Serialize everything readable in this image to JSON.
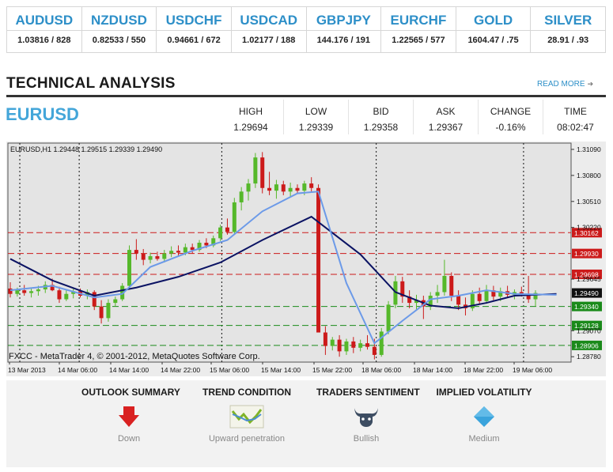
{
  "ticker": [
    {
      "symbol": "AUDUSD",
      "value": "1.03816 / 828"
    },
    {
      "symbol": "NZDUSD",
      "value": "0.82533 / 550"
    },
    {
      "symbol": "USDCHF",
      "value": "0.94661 / 672"
    },
    {
      "symbol": "USDCAD",
      "value": "1.02177 / 188"
    },
    {
      "symbol": "GBPJPY",
      "value": "144.176 / 191"
    },
    {
      "symbol": "EURCHF",
      "value": "1.22565 / 577"
    },
    {
      "symbol": "GOLD",
      "value": "1604.47 / .75"
    },
    {
      "symbol": "SILVER",
      "value": "28.91 / .93"
    }
  ],
  "section": {
    "title": "TECHNICAL ANALYSIS",
    "read_more": "READ MORE",
    "read_more_icon": "arrow-right-icon"
  },
  "instrument": {
    "pair": "EURUSD"
  },
  "quotes": [
    {
      "label": "HIGH",
      "value": "1.29694"
    },
    {
      "label": "LOW",
      "value": "1.29339"
    },
    {
      "label": "BID",
      "value": "1.29358"
    },
    {
      "label": "ASK",
      "value": "1.29367"
    },
    {
      "label": "CHANGE",
      "value": "-0.16%"
    },
    {
      "label": "TIME",
      "value": "08:02:47"
    }
  ],
  "chart_data": {
    "type": "candlestick",
    "header": "EURUSD,H1  1.29448 1.29515 1.29339 1.29490",
    "footer": "FXCC - MetaTrader 4, © 2001-2012, MetaQuotes Software Corp.",
    "ylim": [
      1.2872,
      1.3116
    ],
    "y_ticks": [
      "1.31090",
      "1.30800",
      "1.30510",
      "1.30220",
      "1.29645",
      "1.29070",
      "1.28780"
    ],
    "x_ticks": [
      "13 Mar 2013",
      "14 Mar 06:00",
      "14 Mar 14:00",
      "14 Mar 22:00",
      "15 Mar 06:00",
      "15 Mar 14:00",
      "15 Mar 22:00",
      "18 Mar 06:00",
      "18 Mar 14:00",
      "18 Mar 22:00",
      "19 Mar 06:00"
    ],
    "levels": [
      {
        "value": 1.30162,
        "label": "1.30162",
        "color": "#cc1a1a"
      },
      {
        "value": 1.2993,
        "label": "1.29930",
        "color": "#cc1a1a"
      },
      {
        "value": 1.29698,
        "label": "1.29698",
        "color": "#cc1a1a"
      },
      {
        "value": 1.2949,
        "label": "1.29490",
        "color": "#111111"
      },
      {
        "value": 1.2934,
        "label": "1.29340",
        "color": "#1a8a1a"
      },
      {
        "value": 1.29128,
        "label": "1.29128",
        "color": "#1a8a1a"
      },
      {
        "value": 1.28906,
        "label": "1.28906",
        "color": "#1a8a1a"
      }
    ],
    "candles": [
      {
        "o": 1.2954,
        "h": 1.2961,
        "l": 1.2944,
        "c": 1.2948
      },
      {
        "o": 1.2948,
        "h": 1.2955,
        "l": 1.2945,
        "c": 1.2952
      },
      {
        "o": 1.2952,
        "h": 1.2958,
        "l": 1.2946,
        "c": 1.2949
      },
      {
        "o": 1.2949,
        "h": 1.2954,
        "l": 1.2944,
        "c": 1.2951
      },
      {
        "o": 1.2951,
        "h": 1.2957,
        "l": 1.2946,
        "c": 1.2953
      },
      {
        "o": 1.2953,
        "h": 1.2962,
        "l": 1.2949,
        "c": 1.2958
      },
      {
        "o": 1.2958,
        "h": 1.2965,
        "l": 1.2951,
        "c": 1.2952
      },
      {
        "o": 1.2952,
        "h": 1.2956,
        "l": 1.2938,
        "c": 1.2942
      },
      {
        "o": 1.2942,
        "h": 1.2952,
        "l": 1.294,
        "c": 1.2948
      },
      {
        "o": 1.2948,
        "h": 1.2954,
        "l": 1.2943,
        "c": 1.2951
      },
      {
        "o": 1.2951,
        "h": 1.2954,
        "l": 1.2944,
        "c": 1.2946
      },
      {
        "o": 1.2946,
        "h": 1.2953,
        "l": 1.2942,
        "c": 1.295
      },
      {
        "o": 1.295,
        "h": 1.2952,
        "l": 1.293,
        "c": 1.2934
      },
      {
        "o": 1.2934,
        "h": 1.2941,
        "l": 1.2915,
        "c": 1.2921
      },
      {
        "o": 1.2921,
        "h": 1.2942,
        "l": 1.2917,
        "c": 1.2938
      },
      {
        "o": 1.2938,
        "h": 1.2945,
        "l": 1.2934,
        "c": 1.2942
      },
      {
        "o": 1.2942,
        "h": 1.296,
        "l": 1.294,
        "c": 1.2957
      },
      {
        "o": 1.2957,
        "h": 1.3002,
        "l": 1.2954,
        "c": 1.2997
      },
      {
        "o": 1.2997,
        "h": 1.3009,
        "l": 1.2986,
        "c": 1.2993
      },
      {
        "o": 1.2993,
        "h": 1.2998,
        "l": 1.298,
        "c": 1.2986
      },
      {
        "o": 1.2986,
        "h": 1.2994,
        "l": 1.2982,
        "c": 1.299
      },
      {
        "o": 1.299,
        "h": 1.2995,
        "l": 1.2985,
        "c": 1.2987
      },
      {
        "o": 1.2987,
        "h": 1.2997,
        "l": 1.2983,
        "c": 1.2993
      },
      {
        "o": 1.2993,
        "h": 1.3001,
        "l": 1.2989,
        "c": 1.2996
      },
      {
        "o": 1.2996,
        "h": 1.3002,
        "l": 1.299,
        "c": 1.2994
      },
      {
        "o": 1.2994,
        "h": 1.3004,
        "l": 1.2991,
        "c": 1.3
      },
      {
        "o": 1.3,
        "h": 1.3004,
        "l": 1.2993,
        "c": 1.2997
      },
      {
        "o": 1.2997,
        "h": 1.3008,
        "l": 1.2995,
        "c": 1.3005
      },
      {
        "o": 1.3005,
        "h": 1.301,
        "l": 1.2999,
        "c": 1.3002
      },
      {
        "o": 1.3002,
        "h": 1.3013,
        "l": 1.3,
        "c": 1.301
      },
      {
        "o": 1.301,
        "h": 1.3025,
        "l": 1.3007,
        "c": 1.3022
      },
      {
        "o": 1.3022,
        "h": 1.3032,
        "l": 1.3014,
        "c": 1.3017
      },
      {
        "o": 1.3017,
        "h": 1.3055,
        "l": 1.3015,
        "c": 1.305
      },
      {
        "o": 1.305,
        "h": 1.3067,
        "l": 1.3041,
        "c": 1.3062
      },
      {
        "o": 1.3062,
        "h": 1.3076,
        "l": 1.3052,
        "c": 1.3071
      },
      {
        "o": 1.3071,
        "h": 1.3105,
        "l": 1.3066,
        "c": 1.31
      },
      {
        "o": 1.31,
        "h": 1.3106,
        "l": 1.306,
        "c": 1.3066
      },
      {
        "o": 1.3066,
        "h": 1.3084,
        "l": 1.3058,
        "c": 1.3063
      },
      {
        "o": 1.3063,
        "h": 1.3075,
        "l": 1.3054,
        "c": 1.307
      },
      {
        "o": 1.307,
        "h": 1.3074,
        "l": 1.3058,
        "c": 1.3062
      },
      {
        "o": 1.3062,
        "h": 1.3072,
        "l": 1.3056,
        "c": 1.3066
      },
      {
        "o": 1.3066,
        "h": 1.307,
        "l": 1.306,
        "c": 1.3063
      },
      {
        "o": 1.3063,
        "h": 1.3074,
        "l": 1.3058,
        "c": 1.3071
      },
      {
        "o": 1.3071,
        "h": 1.3078,
        "l": 1.3062,
        "c": 1.3066
      },
      {
        "o": 1.3066,
        "h": 1.307,
        "l": 1.2995,
        "c": 1.2905
      },
      {
        "o": 1.2905,
        "h": 1.2912,
        "l": 1.288,
        "c": 1.289
      },
      {
        "o": 1.289,
        "h": 1.29,
        "l": 1.2885,
        "c": 1.2897
      },
      {
        "o": 1.2897,
        "h": 1.2902,
        "l": 1.2878,
        "c": 1.2884
      },
      {
        "o": 1.2884,
        "h": 1.2898,
        "l": 1.288,
        "c": 1.2895
      },
      {
        "o": 1.2895,
        "h": 1.29,
        "l": 1.2882,
        "c": 1.2888
      },
      {
        "o": 1.2888,
        "h": 1.2897,
        "l": 1.2884,
        "c": 1.2893
      },
      {
        "o": 1.2893,
        "h": 1.2902,
        "l": 1.2886,
        "c": 1.2889
      },
      {
        "o": 1.2889,
        "h": 1.2898,
        "l": 1.2875,
        "c": 1.288
      },
      {
        "o": 1.288,
        "h": 1.291,
        "l": 1.2878,
        "c": 1.2906
      },
      {
        "o": 1.2906,
        "h": 1.294,
        "l": 1.2903,
        "c": 1.2936
      },
      {
        "o": 1.2936,
        "h": 1.2968,
        "l": 1.2932,
        "c": 1.2962
      },
      {
        "o": 1.2962,
        "h": 1.2967,
        "l": 1.2938,
        "c": 1.2945
      },
      {
        "o": 1.2945,
        "h": 1.2952,
        "l": 1.2932,
        "c": 1.2938
      },
      {
        "o": 1.2938,
        "h": 1.2947,
        "l": 1.293,
        "c": 1.2941
      },
      {
        "o": 1.2941,
        "h": 1.2946,
        "l": 1.292,
        "c": 1.2934
      },
      {
        "o": 1.2934,
        "h": 1.295,
        "l": 1.293,
        "c": 1.2946
      },
      {
        "o": 1.2946,
        "h": 1.2958,
        "l": 1.2938,
        "c": 1.295
      },
      {
        "o": 1.295,
        "h": 1.2986,
        "l": 1.2946,
        "c": 1.2968
      },
      {
        "o": 1.2968,
        "h": 1.2972,
        "l": 1.294,
        "c": 1.2946
      },
      {
        "o": 1.2946,
        "h": 1.2952,
        "l": 1.293,
        "c": 1.2936
      },
      {
        "o": 1.2936,
        "h": 1.2944,
        "l": 1.2924,
        "c": 1.2932
      },
      {
        "o": 1.2932,
        "h": 1.2952,
        "l": 1.2929,
        "c": 1.2948
      },
      {
        "o": 1.2948,
        "h": 1.2955,
        "l": 1.2936,
        "c": 1.294
      },
      {
        "o": 1.294,
        "h": 1.2958,
        "l": 1.2937,
        "c": 1.2952
      },
      {
        "o": 1.2952,
        "h": 1.2957,
        "l": 1.2941,
        "c": 1.2945
      },
      {
        "o": 1.2945,
        "h": 1.2955,
        "l": 1.294,
        "c": 1.2951
      },
      {
        "o": 1.2951,
        "h": 1.2957,
        "l": 1.2944,
        "c": 1.2947
      },
      {
        "o": 1.2947,
        "h": 1.2953,
        "l": 1.2942,
        "c": 1.295
      },
      {
        "o": 1.295,
        "h": 1.2956,
        "l": 1.2945,
        "c": 1.2948
      },
      {
        "o": 1.2948,
        "h": 1.2968,
        "l": 1.2938,
        "c": 1.2942
      },
      {
        "o": 1.2942,
        "h": 1.2952,
        "l": 1.2934,
        "c": 1.2949
      }
    ],
    "ma_slow": [
      {
        "i": 0,
        "v": 1.2987
      },
      {
        "i": 6,
        "v": 1.2963
      },
      {
        "i": 12,
        "v": 1.2946
      },
      {
        "i": 18,
        "v": 1.2955
      },
      {
        "i": 24,
        "v": 1.2967
      },
      {
        "i": 30,
        "v": 1.2983
      },
      {
        "i": 36,
        "v": 1.3008
      },
      {
        "i": 43,
        "v": 1.3034
      },
      {
        "i": 50,
        "v": 1.2992
      },
      {
        "i": 55,
        "v": 1.295
      },
      {
        "i": 60,
        "v": 1.2935
      },
      {
        "i": 64,
        "v": 1.2932
      },
      {
        "i": 68,
        "v": 1.2938
      },
      {
        "i": 72,
        "v": 1.2946
      },
      {
        "i": 78,
        "v": 1.2948
      }
    ],
    "ma_fast": [
      {
        "i": 0,
        "v": 1.2952
      },
      {
        "i": 6,
        "v": 1.2957
      },
      {
        "i": 12,
        "v": 1.2944
      },
      {
        "i": 16,
        "v": 1.2948
      },
      {
        "i": 20,
        "v": 1.2978
      },
      {
        "i": 26,
        "v": 1.2996
      },
      {
        "i": 31,
        "v": 1.3008
      },
      {
        "i": 36,
        "v": 1.304
      },
      {
        "i": 41,
        "v": 1.306
      },
      {
        "i": 44,
        "v": 1.3062
      },
      {
        "i": 48,
        "v": 1.296
      },
      {
        "i": 52,
        "v": 1.2893
      },
      {
        "i": 56,
        "v": 1.2918
      },
      {
        "i": 60,
        "v": 1.2942
      },
      {
        "i": 64,
        "v": 1.2946
      },
      {
        "i": 68,
        "v": 1.2952
      },
      {
        "i": 72,
        "v": 1.2948
      },
      {
        "i": 78,
        "v": 1.2947
      }
    ]
  },
  "summary": [
    {
      "label": "OUTLOOK SUMMARY",
      "value": "Down",
      "icon": "down-arrow-icon"
    },
    {
      "label": "TREND CONDITION",
      "value": "Upward penetration",
      "icon": "trend-chart-icon"
    },
    {
      "label": "TRADERS SENTIMENT",
      "value": "Bullish",
      "icon": "bull-icon"
    },
    {
      "label": "IMPLIED VOLATILITY",
      "value": "Medium",
      "icon": "diamond-icon"
    }
  ],
  "colors": {
    "accent": "#2d8fc8",
    "up": "#55b82a",
    "down": "#cc1a1a",
    "ma_slow": "#0b1363",
    "ma_fast": "#6c9ae8"
  }
}
